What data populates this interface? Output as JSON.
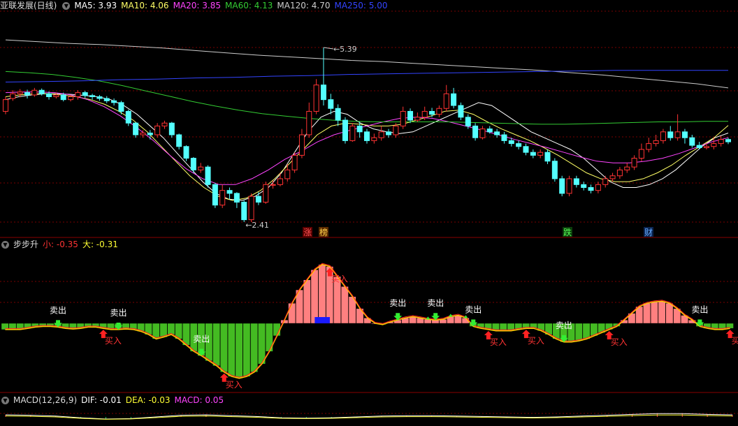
{
  "panel_main": {
    "title": "亚联发展(日线)",
    "indicators": [
      {
        "label": "MA5: 3.93",
        "color": "#ffffff"
      },
      {
        "label": "MA10: 4.06",
        "color": "#ffff66"
      },
      {
        "label": "MA20: 3.85",
        "color": "#ff44ff"
      },
      {
        "label": "MA60: 4.13",
        "color": "#33cc33"
      },
      {
        "label": "MA120: 4.70",
        "color": "#cccccc"
      },
      {
        "label": "MA250: 5.00",
        "color": "#3344ff"
      }
    ],
    "high_label": "5.39",
    "low_label": "2.41",
    "event_tags": [
      {
        "text": "涨",
        "color": "#ff5555",
        "bg": "#5a0000"
      },
      {
        "text": "榜",
        "color": "#ffd24d",
        "bg": "#5a2a00"
      },
      {
        "text": "跌",
        "color": "#55ff55",
        "bg": "#0b3d0b"
      },
      {
        "text": "财",
        "color": "#66aaff",
        "bg": "#0b2550"
      }
    ]
  },
  "panel_bbs": {
    "title": "步步升",
    "small_label": "小: -0.35",
    "big_label": "大: -0.31",
    "sell_label": "卖出",
    "buy_label": "买入"
  },
  "panel_macd": {
    "title": "MACD(12,26,9)",
    "dif_label": "DIF: -0.01",
    "dea_label": "DEA: -0.03",
    "macd_label": "MACD: 0.05"
  },
  "colors": {
    "up": "#ff3333",
    "down": "#54ffff",
    "grid": "#7a0000",
    "bar_pos": "#ff8080",
    "bar_neg": "#44bb22",
    "line_red": "#ff2222",
    "line_yellow": "#ffcc00"
  },
  "chart_data": {
    "type": "candlestick",
    "price_range": [
      2.41,
      5.39
    ],
    "candles": [
      [
        4.3,
        4.5,
        4.25,
        4.55
      ],
      [
        4.52,
        4.6,
        4.48,
        4.66
      ],
      [
        4.6,
        4.63,
        4.54,
        4.68
      ],
      [
        4.62,
        4.58,
        4.52,
        4.67
      ],
      [
        4.58,
        4.66,
        4.55,
        4.7
      ],
      [
        4.66,
        4.6,
        4.57,
        4.69
      ],
      [
        4.6,
        4.55,
        4.5,
        4.64
      ],
      [
        4.55,
        4.58,
        4.52,
        4.62
      ],
      [
        4.58,
        4.5,
        4.47,
        4.62
      ],
      [
        4.5,
        4.55,
        4.47,
        4.58
      ],
      [
        4.55,
        4.62,
        4.5,
        4.66
      ],
      [
        4.62,
        4.57,
        4.53,
        4.65
      ],
      [
        4.57,
        4.55,
        4.5,
        4.6
      ],
      [
        4.55,
        4.52,
        4.48,
        4.58
      ],
      [
        4.52,
        4.48,
        4.44,
        4.56
      ],
      [
        4.48,
        4.45,
        4.4,
        4.52
      ],
      [
        4.45,
        4.3,
        4.25,
        4.48
      ],
      [
        4.3,
        4.1,
        4.05,
        4.33
      ],
      [
        4.1,
        3.9,
        3.85,
        4.12
      ],
      [
        3.9,
        3.93,
        3.85,
        3.98
      ],
      [
        3.93,
        3.9,
        3.82,
        3.98
      ],
      [
        3.9,
        4.05,
        3.85,
        4.1
      ],
      [
        4.05,
        4.1,
        4.0,
        4.14
      ],
      [
        4.1,
        3.9,
        3.85,
        4.12
      ],
      [
        3.9,
        3.7,
        3.65,
        3.92
      ],
      [
        3.7,
        3.5,
        3.45,
        3.72
      ],
      [
        3.5,
        3.3,
        3.25,
        3.52
      ],
      [
        3.3,
        3.35,
        3.25,
        3.42
      ],
      [
        3.35,
        3.05,
        3.0,
        3.38
      ],
      [
        3.05,
        2.7,
        2.65,
        3.08
      ],
      [
        2.7,
        2.95,
        2.65,
        3.05
      ],
      [
        2.95,
        2.9,
        2.8,
        3.0
      ],
      [
        2.9,
        2.75,
        2.65,
        2.92
      ],
      [
        2.75,
        2.45,
        2.41,
        2.78
      ],
      [
        2.45,
        2.85,
        2.41,
        2.9
      ],
      [
        2.85,
        2.75,
        2.7,
        2.92
      ],
      [
        2.75,
        3.05,
        2.72,
        3.1
      ],
      [
        3.05,
        3.05,
        2.98,
        3.12
      ],
      [
        3.05,
        3.15,
        3.02,
        3.25
      ],
      [
        3.15,
        3.3,
        3.1,
        3.4
      ],
      [
        3.3,
        3.55,
        3.25,
        3.6
      ],
      [
        3.55,
        3.9,
        3.5,
        4.0
      ],
      [
        3.9,
        4.3,
        3.85,
        4.45
      ],
      [
        4.3,
        4.75,
        4.25,
        4.85
      ],
      [
        4.75,
        4.5,
        4.4,
        5.39
      ],
      [
        4.5,
        4.35,
        4.25,
        4.6
      ],
      [
        4.35,
        4.15,
        4.05,
        4.42
      ],
      [
        4.15,
        3.8,
        3.75,
        4.2
      ],
      [
        3.8,
        4.05,
        3.78,
        4.1
      ],
      [
        4.05,
        3.95,
        3.85,
        4.12
      ],
      [
        3.95,
        3.8,
        3.75,
        4.0
      ],
      [
        3.8,
        3.85,
        3.75,
        3.92
      ],
      [
        3.85,
        3.95,
        3.8,
        4.05
      ],
      [
        3.95,
        3.9,
        3.85,
        4.0
      ],
      [
        3.9,
        4.05,
        3.85,
        4.1
      ],
      [
        4.05,
        4.3,
        4.0,
        4.38
      ],
      [
        4.3,
        4.15,
        4.1,
        4.35
      ],
      [
        4.15,
        4.2,
        4.12,
        4.28
      ],
      [
        4.2,
        4.3,
        4.15,
        4.38
      ],
      [
        4.3,
        4.25,
        4.2,
        4.36
      ],
      [
        4.25,
        4.35,
        4.2,
        4.4
      ],
      [
        4.35,
        4.6,
        4.3,
        4.75
      ],
      [
        4.6,
        4.4,
        4.35,
        4.7
      ],
      [
        4.4,
        4.2,
        4.15,
        4.45
      ],
      [
        4.2,
        4.05,
        4.0,
        4.25
      ],
      [
        4.05,
        3.85,
        3.8,
        4.1
      ],
      [
        3.85,
        4.0,
        3.82,
        4.05
      ],
      [
        4.0,
        3.95,
        3.92,
        4.05
      ],
      [
        3.95,
        3.9,
        3.85,
        4.0
      ],
      [
        3.9,
        3.8,
        3.75,
        3.95
      ],
      [
        3.8,
        3.75,
        3.7,
        3.85
      ],
      [
        3.75,
        3.7,
        3.65,
        3.8
      ],
      [
        3.7,
        3.6,
        3.55,
        3.75
      ],
      [
        3.6,
        3.55,
        3.5,
        3.65
      ],
      [
        3.55,
        3.6,
        3.5,
        3.65
      ],
      [
        3.6,
        3.45,
        3.4,
        3.65
      ],
      [
        3.45,
        3.15,
        3.1,
        3.5
      ],
      [
        3.15,
        2.9,
        2.85,
        3.2
      ],
      [
        2.9,
        3.15,
        2.85,
        3.2
      ],
      [
        3.15,
        3.05,
        3.0,
        3.2
      ],
      [
        3.05,
        3.0,
        2.95,
        3.1
      ],
      [
        3.0,
        2.95,
        2.9,
        3.05
      ],
      [
        2.95,
        3.05,
        2.9,
        3.1
      ],
      [
        3.05,
        3.15,
        3.0,
        3.2
      ],
      [
        3.15,
        3.2,
        3.1,
        3.25
      ],
      [
        3.2,
        3.3,
        3.15,
        3.35
      ],
      [
        3.3,
        3.35,
        3.25,
        3.42
      ],
      [
        3.35,
        3.5,
        3.3,
        3.55
      ],
      [
        3.5,
        3.65,
        3.45,
        3.75
      ],
      [
        3.65,
        3.75,
        3.6,
        3.85
      ],
      [
        3.75,
        3.8,
        3.7,
        3.9
      ],
      [
        3.8,
        3.95,
        3.75,
        4.0
      ],
      [
        3.95,
        3.85,
        3.8,
        4.05
      ],
      [
        3.85,
        3.95,
        3.8,
        4.25
      ],
      [
        3.95,
        3.85,
        3.75,
        4.0
      ],
      [
        3.85,
        3.72,
        3.68,
        3.9
      ],
      [
        3.72,
        3.68,
        3.65,
        3.78
      ],
      [
        3.68,
        3.7,
        3.65,
        3.75
      ],
      [
        3.7,
        3.75,
        3.65,
        3.85
      ],
      [
        3.75,
        3.82,
        3.7,
        3.88
      ],
      [
        3.82,
        3.78,
        3.74,
        3.85
      ]
    ],
    "ma": {
      "MA5": [
        4.5,
        4.55,
        4.58,
        4.6,
        4.6,
        4.59,
        4.57,
        4.55,
        4.5,
        4.4,
        4.25,
        4.05,
        3.85,
        3.6,
        3.35,
        3.1,
        2.9,
        2.8,
        2.78,
        2.85,
        3.0,
        3.25,
        3.6,
        3.95,
        4.2,
        4.3,
        4.25,
        4.1,
        4.0,
        3.95,
        3.92,
        3.95,
        4.05,
        4.15,
        4.25,
        4.35,
        4.45,
        4.4,
        4.25,
        4.1,
        3.95,
        3.85,
        3.75,
        3.65,
        3.5,
        3.3,
        3.1,
        3.0,
        3.0,
        3.05,
        3.15,
        3.3,
        3.5,
        3.7,
        3.85,
        3.93
      ],
      "MA10": [
        4.55,
        4.58,
        4.6,
        4.6,
        4.58,
        4.55,
        4.5,
        4.42,
        4.3,
        4.15,
        3.95,
        3.7,
        3.45,
        3.2,
        3.0,
        2.85,
        2.78,
        2.82,
        2.95,
        3.15,
        3.4,
        3.65,
        3.9,
        4.05,
        4.1,
        4.08,
        4.05,
        4.05,
        4.08,
        4.15,
        4.22,
        4.3,
        4.32,
        4.25,
        4.12,
        4.0,
        3.9,
        3.8,
        3.68,
        3.55,
        3.4,
        3.25,
        3.15,
        3.1,
        3.1,
        3.15,
        3.25,
        3.38,
        3.55,
        3.7,
        3.85,
        4.06
      ],
      "MA20": [
        4.62,
        4.63,
        4.63,
        4.62,
        4.58,
        4.5,
        4.38,
        4.22,
        4.02,
        3.8,
        3.55,
        3.32,
        3.15,
        3.05,
        3.05,
        3.15,
        3.3,
        3.48,
        3.62,
        3.78,
        3.9,
        3.98,
        4.05,
        4.12,
        4.18,
        4.2,
        4.18,
        4.12,
        4.05,
        3.98,
        3.9,
        3.82,
        3.75,
        3.68,
        3.6,
        3.52,
        3.45,
        3.42,
        3.42,
        3.45,
        3.5,
        3.58,
        3.68,
        3.78,
        3.85
      ],
      "MA60": [
        4.98,
        4.96,
        4.93,
        4.88,
        4.82,
        4.74,
        4.65,
        4.56,
        4.47,
        4.39,
        4.32,
        4.26,
        4.22,
        4.18,
        4.15,
        4.13,
        4.12,
        4.12,
        4.12,
        4.12,
        4.11,
        4.1,
        4.09,
        4.08,
        4.08,
        4.09,
        4.1,
        4.11,
        4.12,
        4.12,
        4.13,
        4.13
      ],
      "MA120": [
        5.52,
        5.49,
        5.46,
        5.44,
        5.41,
        5.38,
        5.34,
        5.3,
        5.26,
        5.23,
        5.2,
        5.17,
        5.15,
        5.12,
        5.09,
        5.06,
        5.03,
        5.0,
        4.96,
        4.92,
        4.87,
        4.82,
        4.77,
        4.7
      ],
      "MA250": [
        4.8,
        4.81,
        4.82,
        4.84,
        4.85,
        4.87,
        4.88,
        4.9,
        4.91,
        4.93,
        4.94,
        4.95,
        4.96,
        4.97,
        4.98,
        4.99,
        5.0,
        5.0,
        5.0,
        5.0
      ]
    },
    "bbs_bars": [
      -0.1,
      -0.1,
      -0.1,
      -0.08,
      -0.06,
      -0.05,
      -0.05,
      -0.06,
      -0.08,
      -0.09,
      -0.08,
      -0.06,
      -0.06,
      -0.08,
      -0.1,
      -0.1,
      -0.09,
      -0.1,
      -0.13,
      -0.18,
      -0.25,
      -0.22,
      -0.18,
      -0.25,
      -0.35,
      -0.45,
      -0.52,
      -0.6,
      -0.68,
      -0.78,
      -0.85,
      -0.88,
      -0.85,
      -0.78,
      -0.65,
      -0.45,
      -0.2,
      0.05,
      0.3,
      0.5,
      0.65,
      0.8,
      0.88,
      0.85,
      0.7,
      0.55,
      0.4,
      0.22,
      0.08,
      0.0,
      -0.02,
      0.02,
      0.05,
      0.08,
      0.1,
      0.08,
      0.06,
      0.05,
      0.06,
      0.1,
      0.12,
      0.08,
      -0.05,
      -0.08,
      -0.1,
      -0.12,
      -0.12,
      -0.12,
      -0.1,
      -0.08,
      -0.08,
      -0.12,
      -0.18,
      -0.25,
      -0.3,
      -0.3,
      -0.28,
      -0.25,
      -0.2,
      -0.15,
      -0.1,
      -0.05,
      0.05,
      0.15,
      0.25,
      0.3,
      0.32,
      0.33,
      0.3,
      0.22,
      0.12,
      0.05,
      -0.05,
      -0.08,
      -0.1,
      -0.1,
      -0.08
    ],
    "bbs_range": [
      -0.95,
      0.95
    ],
    "signals": {
      "sell_idx": [
        7,
        15,
        26,
        52,
        57,
        62,
        74,
        92
      ],
      "buy_idx": [
        13,
        29,
        43,
        64,
        69,
        80,
        96
      ],
      "marker_idx": [
        52,
        56,
        59,
        61
      ]
    },
    "macd_line": [
      0.05,
      0.04,
      0.02,
      -0.02,
      -0.05,
      -0.04,
      0.0,
      0.04,
      0.05,
      0.03,
      0.01,
      -0.02,
      -0.03,
      -0.02,
      0.0,
      0.02,
      0.03,
      0.03,
      0.02,
      0.01,
      0.0,
      -0.01,
      0.0,
      0.02,
      0.04,
      0.06,
      0.08,
      0.08,
      0.06,
      0.05
    ]
  }
}
